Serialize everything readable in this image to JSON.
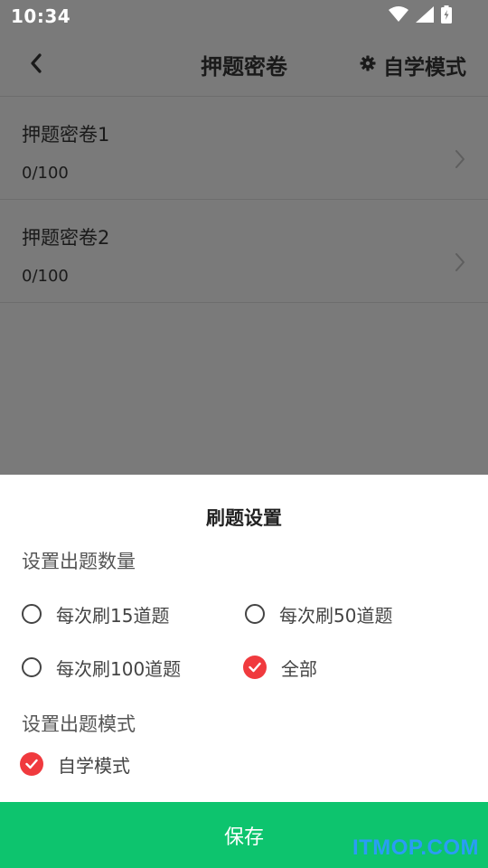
{
  "status_bar": {
    "time": "10:34",
    "icons": [
      "wifi-icon",
      "signal-icon",
      "battery-charging-icon"
    ]
  },
  "app_bar": {
    "back_icon": "chevron-left-icon",
    "title": "押题密卷",
    "mode_icon": "gear-icon",
    "mode_label": "自学模式"
  },
  "list": {
    "items": [
      {
        "title": "押题密卷1",
        "progress": "0/100"
      },
      {
        "title": "押题密卷2",
        "progress": "0/100"
      }
    ]
  },
  "sheet": {
    "title": "刷题设置",
    "count_section": {
      "label": "设置出题数量",
      "options": [
        {
          "label": "每次刷15道题",
          "checked": false
        },
        {
          "label": "每次刷50道题",
          "checked": false
        },
        {
          "label": "每次刷100道题",
          "checked": false
        },
        {
          "label": "全部",
          "checked": true
        }
      ]
    },
    "mode_section": {
      "label": "设置出题模式",
      "options": [
        {
          "label": "自学模式",
          "checked": true
        }
      ]
    },
    "save_label": "保存"
  },
  "watermark": "ITMOP.COM",
  "colors": {
    "accent_green": "#0dc46e",
    "checked_red": "#f03a3e",
    "dim_background": "#7a7a7a",
    "watermark_blue": "#2a9df4"
  }
}
